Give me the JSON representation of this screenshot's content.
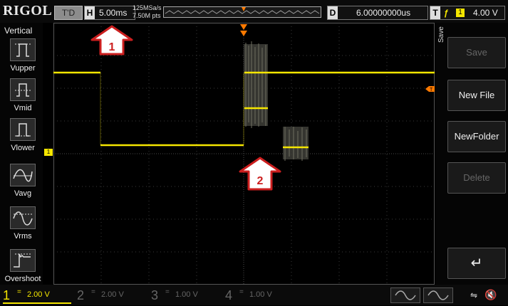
{
  "header": {
    "logo": "RIGOL",
    "run_state": "T'D",
    "horizontal": {
      "label": "H",
      "value": "5.00ms"
    },
    "sample_rate": "125MSa/s",
    "memory_depth": "7.50M pts",
    "delay": {
      "label": "D",
      "value": "6.00000000us"
    },
    "trigger": {
      "label": "T",
      "edge": "ƒ",
      "source": "1",
      "level": "4.00 V"
    }
  },
  "left_panel": {
    "title": "Vertical",
    "items": [
      {
        "label": "Vupper",
        "icon": "vupper-icon"
      },
      {
        "label": "Vmid",
        "icon": "vmid-icon"
      },
      {
        "label": "Vlower",
        "icon": "vlower-icon"
      },
      {
        "label": "Vavg",
        "icon": "vavg-icon"
      },
      {
        "label": "Vrms",
        "icon": "vrms-icon"
      },
      {
        "label": "Overshoot",
        "icon": "overshoot-icon"
      }
    ]
  },
  "right_panel": {
    "title": "Save",
    "buttons": [
      {
        "label": "Save",
        "enabled": false
      },
      {
        "label": "New File",
        "enabled": true
      },
      {
        "label": "NewFolder",
        "enabled": true
      },
      {
        "label": "Delete",
        "enabled": false
      },
      {
        "label": "↵",
        "enabled": true
      }
    ]
  },
  "annotations": [
    {
      "label": "1"
    },
    {
      "label": "2"
    }
  ],
  "markers": {
    "channel1": "1",
    "trigger_level": "T"
  },
  "channels": [
    {
      "num": "1",
      "coupling": "=",
      "scale": "2.00 V",
      "color": "#f5e600",
      "active": true
    },
    {
      "num": "2",
      "coupling": "=",
      "scale": "2.00 V",
      "color": "#666666",
      "active": false
    },
    {
      "num": "3",
      "coupling": "=",
      "scale": "1.00 V",
      "color": "#666666",
      "active": false
    },
    {
      "num": "4",
      "coupling": "=",
      "scale": "1.00 V",
      "color": "#666666",
      "active": false
    }
  ],
  "bottom_icons": [
    "wave-gen-1-icon",
    "wave-gen-2-icon",
    "usb-icon",
    "speaker-icon"
  ],
  "colors": {
    "trace": "#f5e600",
    "grid": "#3a3a3a",
    "trigger_marker": "#ff7a00",
    "annotation": "#cc1f1f"
  }
}
